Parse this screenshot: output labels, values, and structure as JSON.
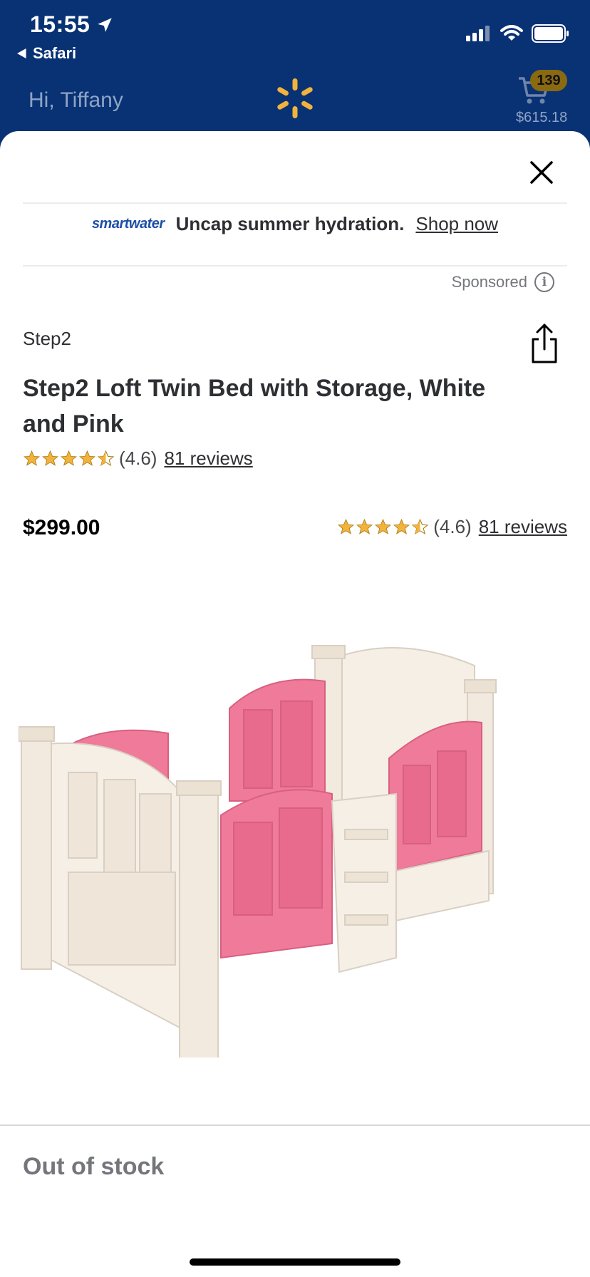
{
  "status": {
    "time": "15:55",
    "back_app": "Safari"
  },
  "header": {
    "greeting": "Hi, Tiffany",
    "cart_count": "139",
    "cart_total": "$615.18",
    "colors": {
      "background": "#093275",
      "spark": "#f2b33d"
    }
  },
  "ad": {
    "logo_text": "smartwater",
    "headline": "Uncap summer hydration.",
    "link_label": "Shop now",
    "sponsored_label": "Sponsored"
  },
  "product": {
    "brand": "Step2",
    "title": "Step2 Loft Twin Bed with Storage, White and Pink",
    "rating_value": 4.6,
    "rating_text": "(4.6)",
    "reviews_label": "81 reviews",
    "price": "$299.00",
    "availability": "Out of stock"
  },
  "icons": {
    "location": "location-arrow-icon",
    "back": "back-triangle-icon",
    "close": "close-icon",
    "share": "share-icon",
    "info": "info-icon",
    "cart": "cart-icon",
    "spark": "walmart-spark-icon"
  },
  "colors": {
    "star": "#f2b33d",
    "text": "#2e2f32",
    "muted": "#74767c",
    "bed_pink": "#f07a9a",
    "bed_white": "#f6efe6"
  }
}
